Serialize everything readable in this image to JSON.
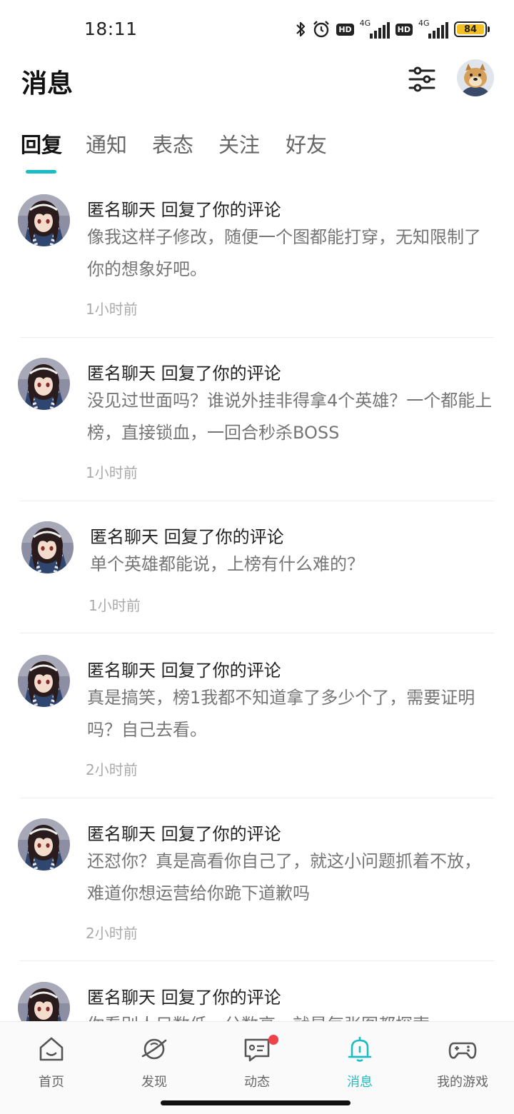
{
  "status_bar": {
    "time": "18:11",
    "network_1": "4G",
    "network_2": "4G",
    "hd_badge": "HD",
    "battery": "84"
  },
  "header": {
    "title": "消息"
  },
  "tabs": [
    {
      "label": "回复",
      "active": true
    },
    {
      "label": "通知",
      "active": false
    },
    {
      "label": "表态",
      "active": false
    },
    {
      "label": "关注",
      "active": false
    },
    {
      "label": "好友",
      "active": false
    }
  ],
  "messages": [
    {
      "title": "匿名聊天 回复了你的评论",
      "body": "像我这样子修改，随便一个图都能打穿，无知限制了你的想象好吧。",
      "time": "1小时前"
    },
    {
      "title": "匿名聊天 回复了你的评论",
      "body": "没见过世面吗？谁说外挂非得拿4个英雄？一个都能上榜，直接锁血，一回合秒杀BOSS",
      "time": "1小时前"
    },
    {
      "title": "匿名聊天 回复了你的评论",
      "body": "单个英雄都能说，上榜有什么难的？",
      "time": "1小时前"
    },
    {
      "title": "匿名聊天 回复了你的评论",
      "body": "真是搞笑，榜1我都不知道拿了多少个了，需要证明吗？自己去看。",
      "time": "2小时前"
    },
    {
      "title": "匿名聊天 回复了你的评论",
      "body": "还怼你？真是高看你自己了，就这小问题抓着不放，难道你想运营给你跪下道歉吗",
      "time": "2小时前"
    },
    {
      "title": "匿名聊天 回复了你的评论",
      "body": "你看别人只数低，分数高，就是每张图都探索",
      "time": ""
    }
  ],
  "bottom_nav": [
    {
      "label": "首页",
      "icon": "home-icon"
    },
    {
      "label": "发现",
      "icon": "discover-icon"
    },
    {
      "label": "动态",
      "icon": "feed-icon"
    },
    {
      "label": "消息",
      "icon": "bell-icon",
      "active": true
    },
    {
      "label": "我的游戏",
      "icon": "gamepad-icon"
    }
  ],
  "colors": {
    "accent": "#1bbcc4",
    "badge": "#f0424a",
    "battery": "#f2c024"
  }
}
